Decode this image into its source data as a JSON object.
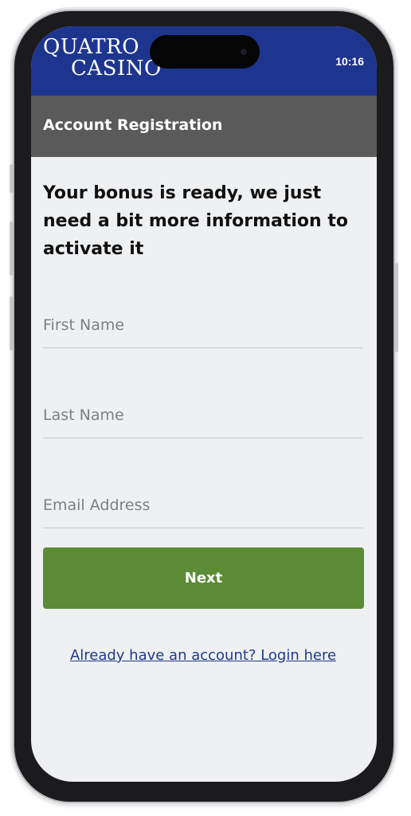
{
  "status_bar": {
    "logo_line1": "QUATRO",
    "logo_line2": "CASINO",
    "time": "10:16"
  },
  "header": {
    "title": "Account Registration"
  },
  "form": {
    "headline": "Your bonus is ready, we just need a bit more information to activate it",
    "first_name_placeholder": "First Name",
    "last_name_placeholder": "Last Name",
    "email_placeholder": "Email Address",
    "next_label": "Next",
    "login_link": "Already have an account? Login here"
  },
  "colors": {
    "brand_blue": "#1e3590",
    "header_gray": "#5a5a5a",
    "button_green": "#5b8c35",
    "link_blue": "#1f3a8c",
    "page_background": "#eff0f2"
  },
  "icons": {
    "camera": "camera-icon"
  }
}
